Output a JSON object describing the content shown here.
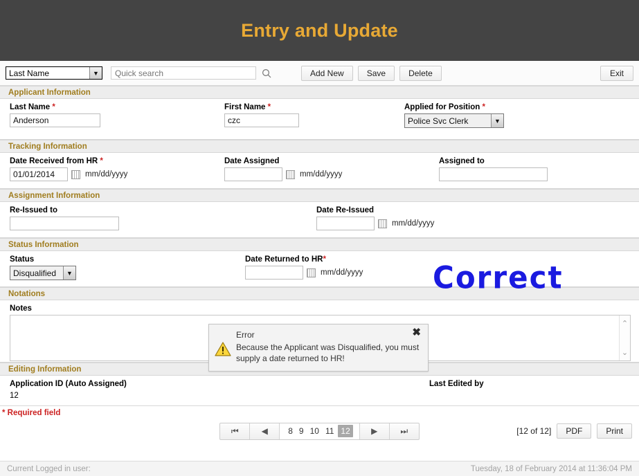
{
  "header": {
    "title": "Entry and Update"
  },
  "toolbar": {
    "field_select_value": "Last Name",
    "search_placeholder": "Quick search",
    "search_value": "",
    "add_new_label": "Add New",
    "save_label": "Save",
    "delete_label": "Delete",
    "exit_label": "Exit"
  },
  "sections": {
    "applicant": {
      "header": "Applicant Information",
      "last_name_label": "Last Name",
      "last_name_value": "Anderson",
      "first_name_label": "First Name",
      "first_name_value": "czc",
      "position_label": "Applied for Position",
      "position_value": "Police Svc Clerk"
    },
    "tracking": {
      "header": "Tracking Information",
      "date_received_label": "Date Received from HR",
      "date_received_value": "01/01/2014",
      "date_received_mask": "mm/dd/yyyy",
      "date_assigned_label": "Date Assigned",
      "date_assigned_value": "",
      "date_assigned_mask": "mm/dd/yyyy",
      "assigned_to_label": "Assigned to",
      "assigned_to_value": ""
    },
    "assignment": {
      "header": "Assignment Information",
      "reissued_to_label": "Re-Issued to",
      "reissued_to_value": "",
      "date_reissued_label": "Date Re-Issued",
      "date_reissued_value": "",
      "date_reissued_mask": "mm/dd/yyyy"
    },
    "status": {
      "header": "Status Information",
      "status_label": "Status",
      "status_value": "Disqualified",
      "date_returned_label": "Date Returned to HR",
      "date_returned_value": "",
      "date_returned_mask": "mm/dd/yyyy"
    },
    "notations": {
      "header": "Notations",
      "notes_label": "Notes",
      "notes_value": ""
    },
    "editing": {
      "header": "Editing Information",
      "app_id_label": "Application ID (Auto Assigned)",
      "app_id_value": "12",
      "last_edited_label": "Last Edited by",
      "last_edited_value": ""
    }
  },
  "error_dialog": {
    "title": "Error",
    "message": "Because the Applicant was Disqualified, you must supply a date returned to HR!",
    "close_icon": "close-icon",
    "warning_icon": "warning-triangle-icon"
  },
  "annotation": {
    "text": "Correct",
    "color": "#1a1ae0"
  },
  "required_note": "* Required field",
  "pager": {
    "first_icon": "first-page-icon",
    "prev_icon": "previous-page-icon",
    "next_icon": "next-page-icon",
    "last_icon": "last-page-icon",
    "pages": [
      "8",
      "9",
      "10",
      "11",
      "12"
    ],
    "current_page": "12",
    "count_label": "[12 of 12]",
    "pdf_label": "PDF",
    "print_label": "Print"
  },
  "statusbar": {
    "user_label": "Current Logged in user:",
    "timestamp": "Tuesday, 18 of February 2014 at 11:36:04 PM"
  },
  "colors": {
    "banner_bg": "#444444",
    "title_gold": "#e8a935",
    "section_label": "#a07d1f",
    "required_red": "#cc2222",
    "annotation_blue": "#1a1ae0"
  }
}
